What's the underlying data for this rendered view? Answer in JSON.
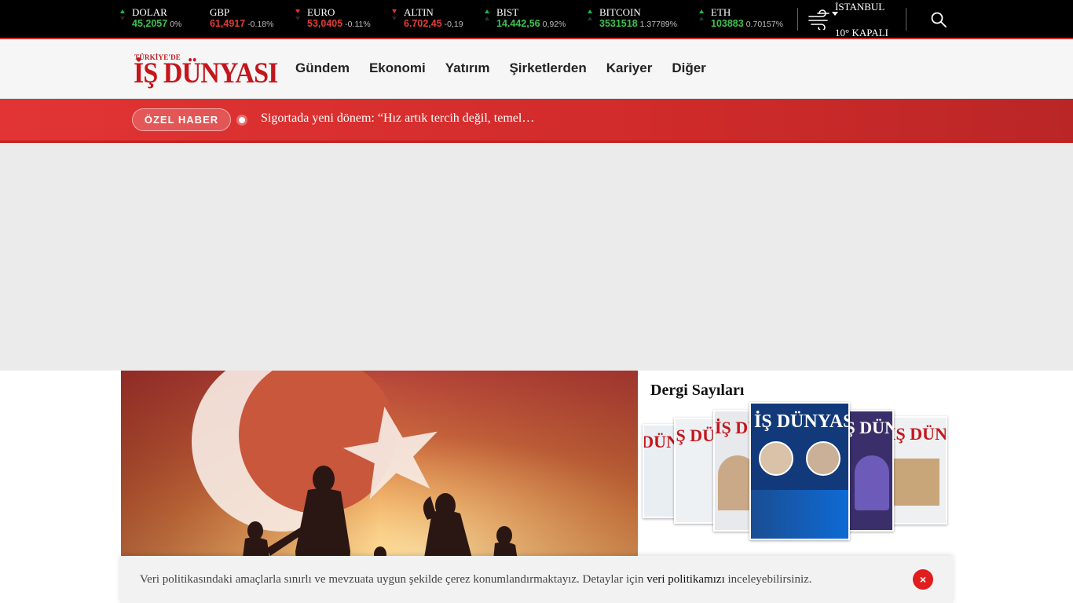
{
  "ticker": [
    {
      "name": "DOLAR",
      "value": "45,2057",
      "change": "0%",
      "direction": "up"
    },
    {
      "name": "GBP",
      "value": "61,4917",
      "change": "-0.18%",
      "direction": "down"
    },
    {
      "name": "EURO",
      "value": "53,0405",
      "change": "-0.11%",
      "direction": "down"
    },
    {
      "name": "ALTIN",
      "value": "6.702,45",
      "change": "-0,19",
      "direction": "down"
    },
    {
      "name": "BIST",
      "value": "14.442,56",
      "change": "0,92%",
      "direction": "up"
    },
    {
      "name": "BITCOIN",
      "value": "3531518",
      "change": "1.37789%",
      "direction": "up"
    },
    {
      "name": "ETH",
      "value": "103883",
      "change": "0.70157%",
      "direction": "up"
    }
  ],
  "weather": {
    "city": "İSTANBUL",
    "temp": "10° KAPALI",
    "icon": "wind-icon"
  },
  "logo": {
    "small": "TÜRKİYE'DE",
    "big": "İŞ DÜNYASI"
  },
  "nav": [
    "Gündem",
    "Ekonomi",
    "Yatırım",
    "Şirketlerden",
    "Kariyer",
    "Diğer"
  ],
  "breaking": {
    "badge": "ÖZEL HABER",
    "headline": "Sigortada yeni dönem: “Hız artık tercih değil, temel…"
  },
  "dergi": {
    "title": "Dergi Sayıları",
    "cover_title": "İŞ DÜNYASI"
  },
  "cookie": {
    "text_before": "Veri politikasındaki amaçlarla sınırlı ve mevzuata uygun şekilde çerez konumlandırmaktayız. Detaylar için ",
    "link": "veri politikamızı",
    "text_after": " inceleyebilirsiniz.",
    "close": "×"
  },
  "colors": {
    "brand": "#c4161c",
    "up": "#3ec14f",
    "down": "#e23b3b",
    "breaking": "#d12b2b"
  }
}
